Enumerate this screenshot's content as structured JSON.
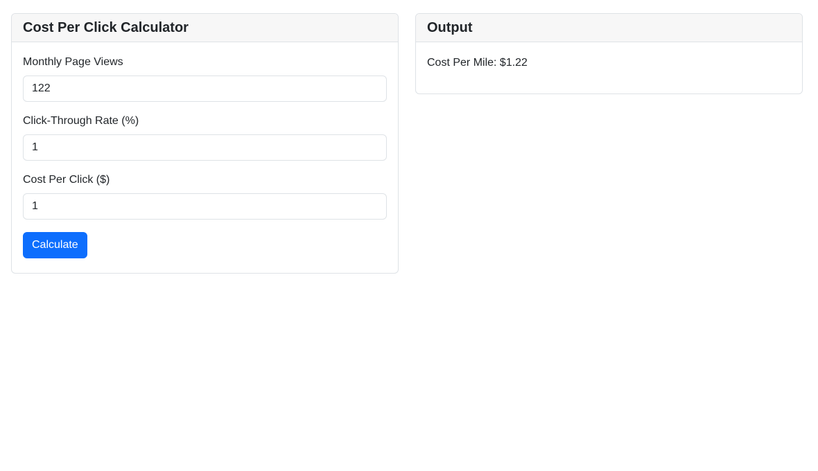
{
  "calculator": {
    "title": "Cost Per Click Calculator",
    "fields": [
      {
        "label": "Monthly Page Views",
        "value": "122"
      },
      {
        "label": "Click-Through Rate (%)",
        "value": "1"
      },
      {
        "label": "Cost Per Click ($)",
        "value": "1"
      }
    ],
    "button_label": "Calculate"
  },
  "output": {
    "title": "Output",
    "result_text": "Cost Per Mile: $1.22"
  },
  "colors": {
    "primary_button": "#0d6efd",
    "card_header_bg": "#f7f7f7",
    "border": "#dee2e6"
  }
}
